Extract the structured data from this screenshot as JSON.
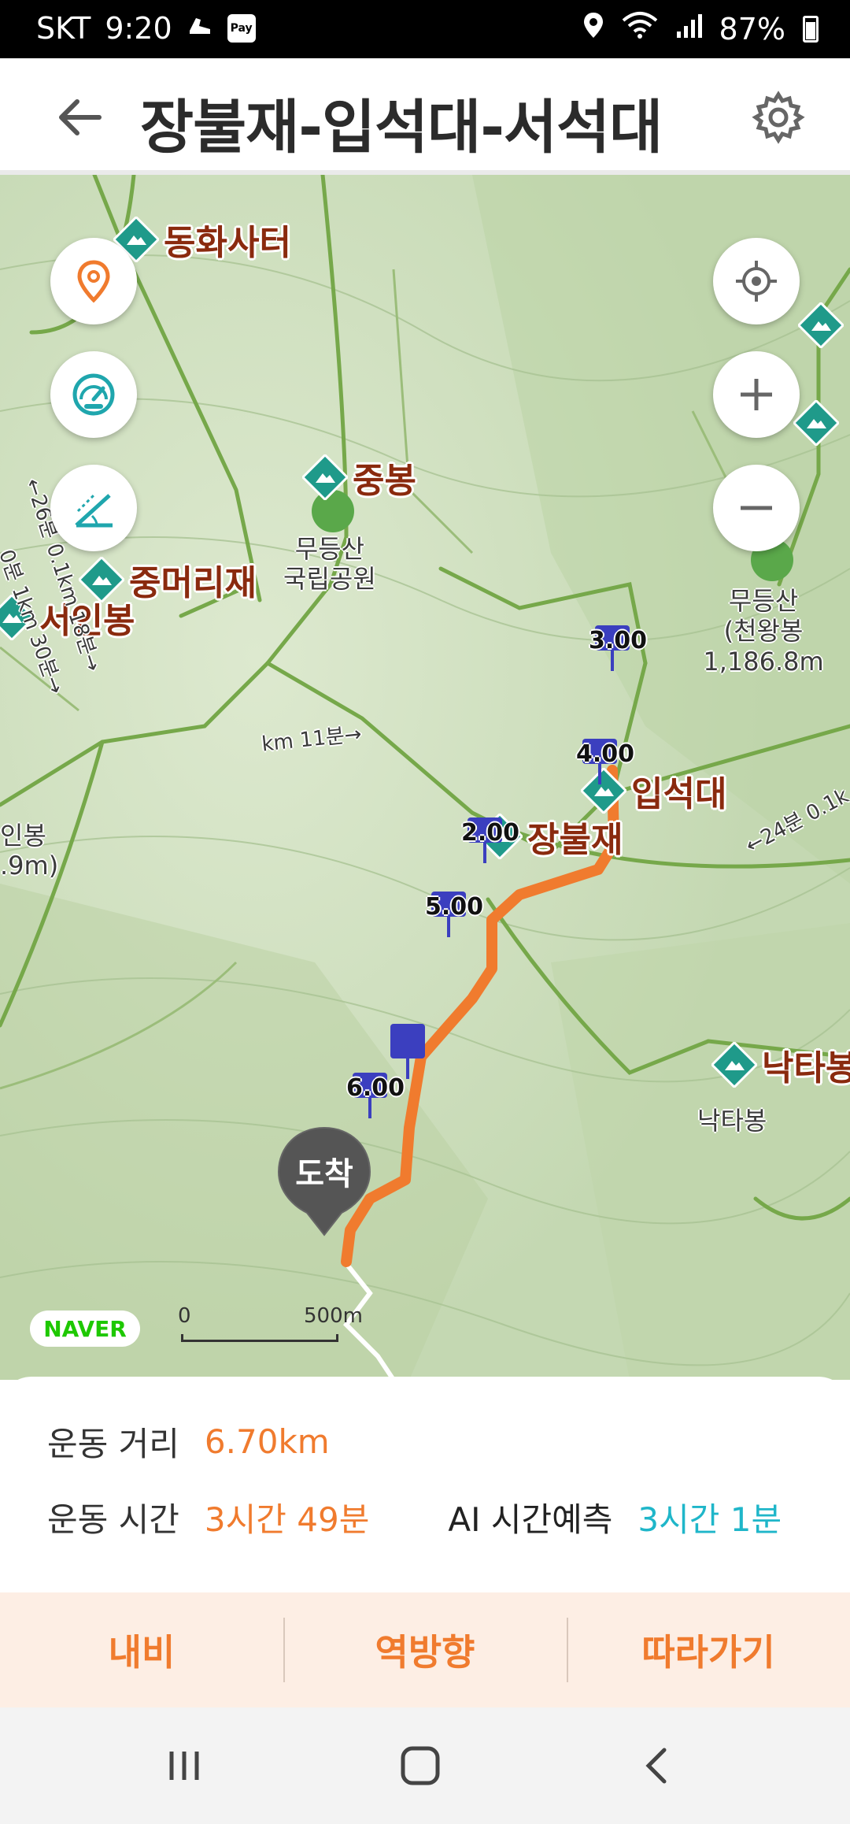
{
  "status_bar": {
    "carrier": "SKT",
    "time": "9:20",
    "battery": "87%",
    "icons": [
      "shoe-icon",
      "pay-icon",
      "location-icon",
      "wifi-icon",
      "signal-icon",
      "battery-icon"
    ]
  },
  "header": {
    "title": "장불재-입석대-서석대",
    "back_icon": "arrow-left-icon",
    "settings_icon": "gear-icon"
  },
  "map": {
    "left_buttons": [
      "location-pin-icon",
      "speedometer-icon",
      "slope-icon"
    ],
    "right_buttons": [
      "locate-me-icon",
      "zoom-in-icon",
      "zoom-out-icon"
    ],
    "peaks": [
      "동화사터",
      "중봉",
      "중머리재",
      "서인봉",
      "장불재",
      "입석대",
      "낙타봉"
    ],
    "labels": {
      "mudeungsan_park": "무등산\n국립공원",
      "mudeungsan_summit": "무등산\n(천왕봉1,186.8m",
      "seoinbong_partial": "인봉\n.9m)",
      "naktabong_sub": "낙타봉",
      "trail_time_1": "←26분 0.1km 18분→",
      "trail_time_2": "0분 1km 30분→",
      "trail_time_3": "km 11분→",
      "trail_time_4": "←24분 0.1k"
    },
    "km_markers": [
      "3.00",
      "4.00",
      "2.00",
      "5.00",
      "6.00"
    ],
    "arrival_label": "도착",
    "brand": "NAVER",
    "scale_start": "0",
    "scale_end": "500m",
    "colors": {
      "route": "#f07b2e",
      "marker": "#3b3fbf",
      "peak": "#1f9a8a"
    }
  },
  "info": {
    "distance_label": "운동 거리",
    "distance_value": "6.70km",
    "time_label": "운동 시간",
    "time_value": "3시간 49분",
    "ai_label": "AI 시간예측",
    "ai_value": "3시간 1분"
  },
  "actions": {
    "navigate": "내비",
    "reverse": "역방향",
    "follow": "따라가기"
  },
  "nav_bar": [
    "recent-apps-icon",
    "home-icon",
    "back-icon"
  ]
}
